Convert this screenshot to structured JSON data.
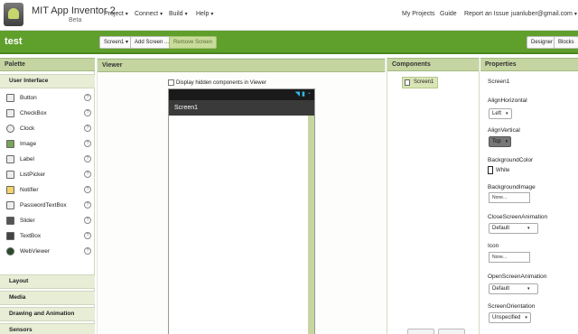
{
  "app": {
    "title": "MIT App Inventor 2",
    "subtitle": "Beta"
  },
  "menus": [
    {
      "label": "Project"
    },
    {
      "label": "Connect"
    },
    {
      "label": "Build"
    },
    {
      "label": "Help"
    }
  ],
  "right_links": {
    "my_projects": "My Projects",
    "guide": "Guide",
    "report": "Report an Issue",
    "user": "juanluber@gmail.com"
  },
  "project": {
    "name": "test",
    "screen_select": "Screen1",
    "add_screen": "Add Screen ...",
    "remove_screen": "Remove Screen",
    "designer": "Designer",
    "blocks": "Blocks"
  },
  "palette": {
    "header": "Palette",
    "active_category": "User Interface",
    "items": [
      {
        "label": "Button",
        "icon": "button-icon"
      },
      {
        "label": "CheckBox",
        "icon": "checkbox-icon"
      },
      {
        "label": "Clock",
        "icon": "clock-icon"
      },
      {
        "label": "Image",
        "icon": "image-icon"
      },
      {
        "label": "Label",
        "icon": "label-icon"
      },
      {
        "label": "ListPicker",
        "icon": "listpicker-icon"
      },
      {
        "label": "Notifier",
        "icon": "notifier-icon"
      },
      {
        "label": "PasswordTextBox",
        "icon": "password-icon"
      },
      {
        "label": "Slider",
        "icon": "slider-icon"
      },
      {
        "label": "TextBox",
        "icon": "textbox-icon"
      },
      {
        "label": "WebViewer",
        "icon": "webviewer-icon"
      }
    ],
    "categories": [
      "Layout",
      "Media",
      "Drawing and Animation",
      "Sensors"
    ]
  },
  "viewer": {
    "header": "Viewer",
    "hidden_toggle": "Display hidden components in Viewer",
    "screen_title": "Screen1"
  },
  "components": {
    "header": "Components",
    "tree_item": "Screen1"
  },
  "properties": {
    "header": "Properties",
    "selected": "Screen1",
    "align_horizontal_label": "AlignHorizontal",
    "align_horizontal_value": "Left",
    "align_vertical_label": "AlignVertical",
    "align_vertical_value": "Top",
    "bg_color_label": "BackgroundColor",
    "bg_color_value": "White",
    "bg_image_label": "BackgroundImage",
    "bg_image_value": "None...",
    "close_anim_label": "CloseScreenAnimation",
    "close_anim_value": "Default",
    "icon_label": "Icon",
    "icon_value": "None...",
    "open_anim_label": "OpenScreenAnimation",
    "open_anim_value": "Default",
    "orientation_label": "ScreenOrientation",
    "orientation_value": "Unspecified"
  },
  "colors": {
    "brand_green": "#5f9f2b",
    "panel_header": "#c5d5a2"
  }
}
